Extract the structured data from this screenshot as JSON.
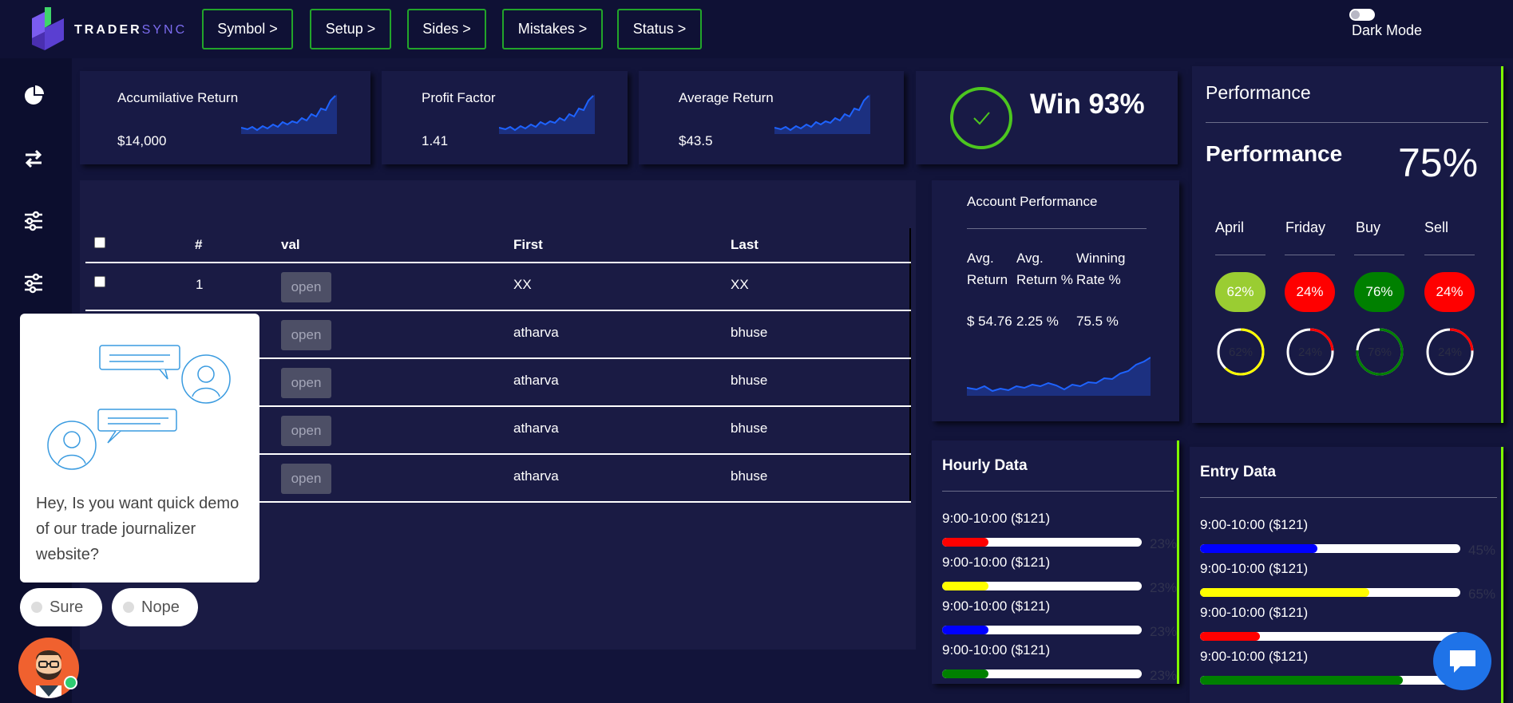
{
  "app": {
    "logo_primary": "TRADER",
    "logo_secondary": "SYNC",
    "accent_color": "#22a52a",
    "brand_color": "#7c6cf0"
  },
  "filters": [
    {
      "label": "Symbol >"
    },
    {
      "label": "Setup >"
    },
    {
      "label": "Sides >"
    },
    {
      "label": "Mistakes >"
    },
    {
      "label": "Status >"
    }
  ],
  "dark_mode": {
    "label": "Dark Mode",
    "enabled": false
  },
  "sidebar": {
    "icons": [
      "pie-chart-icon",
      "swap-arrows-icon",
      "sliders-icon",
      "sliders-icon"
    ]
  },
  "stats": [
    {
      "title": "Accumilative Return",
      "value": "$14,000"
    },
    {
      "title": "Profit Factor",
      "value": "1.41"
    },
    {
      "title": "Average Return",
      "value": "$43.5"
    }
  ],
  "win": {
    "label": "Win 93%",
    "icon": "check-circle-icon"
  },
  "table": {
    "columns": [
      "#",
      "val",
      "First",
      "Last"
    ],
    "open_label": "open",
    "rows": [
      {
        "num": "1",
        "first": "XX",
        "last": "XX"
      },
      {
        "num": "",
        "first": "atharva",
        "last": "bhuse"
      },
      {
        "num": "",
        "first": "atharva",
        "last": "bhuse"
      },
      {
        "num": "",
        "first": "atharva",
        "last": "bhuse"
      },
      {
        "num": "",
        "first": "atharva",
        "last": "bhuse"
      }
    ]
  },
  "account_performance": {
    "title": "Account Performance",
    "col1_label_line1": "Avg.",
    "col1_label_line2": "Return",
    "col2_label_line1": "Avg.",
    "col2_label_line2": "Return %",
    "col3_label_line1": "Winning",
    "col3_label_line2": "Rate %",
    "avg_return": "$ 54.76",
    "avg_return_pct": "2.25 %",
    "winning_rate": "75.5 %"
  },
  "performance": {
    "header": "Performance",
    "title": "Performance",
    "value": "75%",
    "columns": [
      {
        "label": "April",
        "pct": "62%",
        "fraction": 0.62,
        "pill_color": "#9acd32",
        "ring_color": "#ffff00"
      },
      {
        "label": "Friday",
        "pct": "24%",
        "fraction": 0.24,
        "pill_color": "#ff0000",
        "ring_color": "#ff0000"
      },
      {
        "label": "Buy",
        "pct": "76%",
        "fraction": 0.76,
        "pill_color": "#008000",
        "ring_color": "#008000"
      },
      {
        "label": "Sell",
        "pct": "24%",
        "fraction": 0.24,
        "pill_color": "#ff0000",
        "ring_color": "#ff0000"
      }
    ]
  },
  "hourly": {
    "title": "Hourly Data",
    "rows": [
      {
        "label": "9:00-10:00 ($121)",
        "pct": "23%",
        "fraction": 0.23,
        "color": "#ff0000"
      },
      {
        "label": "9:00-10:00 ($121)",
        "pct": "23%",
        "fraction": 0.23,
        "color": "#ffff00"
      },
      {
        "label": "9:00-10:00 ($121)",
        "pct": "23%",
        "fraction": 0.23,
        "color": "#0000ff"
      },
      {
        "label": "9:00-10:00 ($121)",
        "pct": "23%",
        "fraction": 0.23,
        "color": "#008000"
      }
    ]
  },
  "entry": {
    "title": "Entry Data",
    "rows": [
      {
        "label": "9:00-10:00 ($121)",
        "pct": "45%",
        "fraction": 0.45,
        "color": "#0000ff"
      },
      {
        "label": "9:00-10:00 ($121)",
        "pct": "65%",
        "fraction": 0.65,
        "color": "#ffff00"
      },
      {
        "label": "9:00-10:00 ($121)",
        "pct": "",
        "fraction": 0.23,
        "color": "#ff0000"
      },
      {
        "label": "9:00-10:00 ($121)",
        "pct": "",
        "fraction": 0.78,
        "color": "#008000"
      }
    ]
  },
  "chat": {
    "message": "Hey, Is you want quick demo of our trade journalizer website?",
    "options": [
      "Sure",
      "Nope"
    ]
  }
}
